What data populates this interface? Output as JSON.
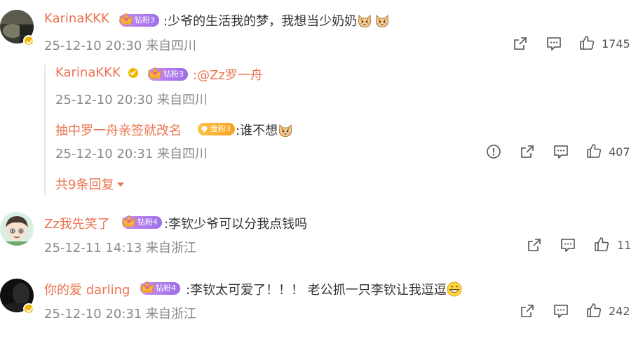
{
  "comments": [
    {
      "user": "KarinaKKK",
      "badge": "钻粉3",
      "text": ":少爷的生活我的梦，我想当少奶奶",
      "time": "25-12-10 20:30 来自四川",
      "likes": "1745",
      "replies": [
        {
          "user": "KarinaKKK",
          "badge": "钻粉3",
          "text": ":@Zz罗一舟",
          "time": "25-12-10 20:30 来自四川"
        },
        {
          "user": "抽中罗一舟亲签就改名",
          "badge": "金粉3",
          "text": ":谁不想",
          "time": "25-12-10 20:31 来自四川",
          "likes": "407"
        }
      ],
      "more_replies": "共9条回复"
    },
    {
      "user": "Zz我先笑了",
      "badge": "钻粉4",
      "text": ":李钦少爷可以分我点钱吗",
      "time": "25-12-11 14:13 来自浙江",
      "likes": "11"
    },
    {
      "user": "你的爱 darling",
      "badge": "钻粉4",
      "text": ":李钦太可爱了！！！ 老公抓一只李钦让我逗逗",
      "time": "25-12-10 20:31 来自浙江",
      "likes": "242"
    }
  ],
  "icons": {
    "share": "share-icon",
    "comment": "comment-icon",
    "like": "like-icon",
    "report": "report-icon",
    "verified": "verified-icon",
    "cat_emoji": "cat-emoji-icon",
    "grin_emoji": "grin-emoji-icon",
    "caret": "caret-down-icon"
  },
  "colors": {
    "username": "#eb7350",
    "meta": "#8a8a8a",
    "verified": "#f2b600",
    "badge_diamond": "#b07cf0",
    "badge_gold": "#f7b32b"
  }
}
